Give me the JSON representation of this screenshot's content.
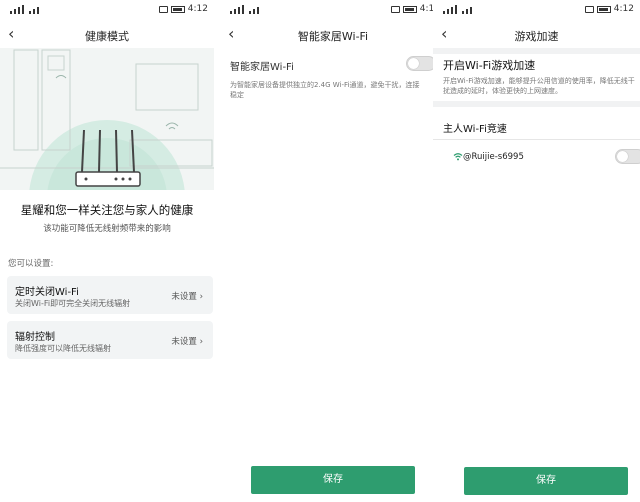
{
  "status_bar": {
    "time": "4:12"
  },
  "screen1": {
    "title": "健康模式",
    "headline": "星耀和您一样关注您与家人的健康",
    "subline": "该功能可降低无线射频带来的影响",
    "section_label": "您可以设置:",
    "items": [
      {
        "title": "定时关闭Wi-Fi",
        "desc": "关闭Wi-Fi即可完全关闭无线辐射",
        "status": "未设置"
      },
      {
        "title": "辐射控制",
        "desc": "降低强度可以降低无线辐射",
        "status": "未设置"
      }
    ]
  },
  "screen2": {
    "title": "智能家居Wi-Fi",
    "toggle_label": "智能家居Wi-Fi",
    "toggle_on": false,
    "description_line1": "为智能家居设备提供独立的2.4G Wi-Fi通道，避免干扰，连接",
    "description_line2": "稳定",
    "save_label": "保存"
  },
  "screen3": {
    "title": "游戏加速",
    "heading": "开启Wi-Fi游戏加速",
    "description_line1": "开启Wi-Fi游戏加速，能够提升公用信道的使用率，降低无线干",
    "description_line2": "扰造成的延时，体验更快的上网速度。",
    "section_title": "主人Wi-Fi竞速",
    "ssid": "@Ruijie-s6995",
    "toggle_on": false,
    "save_label": "保存"
  },
  "colors": {
    "accent": "#2e9d6f",
    "hero_bg": "#f2f5f4",
    "card_bg": "#f2f4f5"
  },
  "icons": [
    "back-arrow-icon",
    "signal-icon",
    "wifi-status-icon",
    "battery-icon",
    "chevron-right-icon",
    "router-illustration",
    "wifi-icon"
  ]
}
